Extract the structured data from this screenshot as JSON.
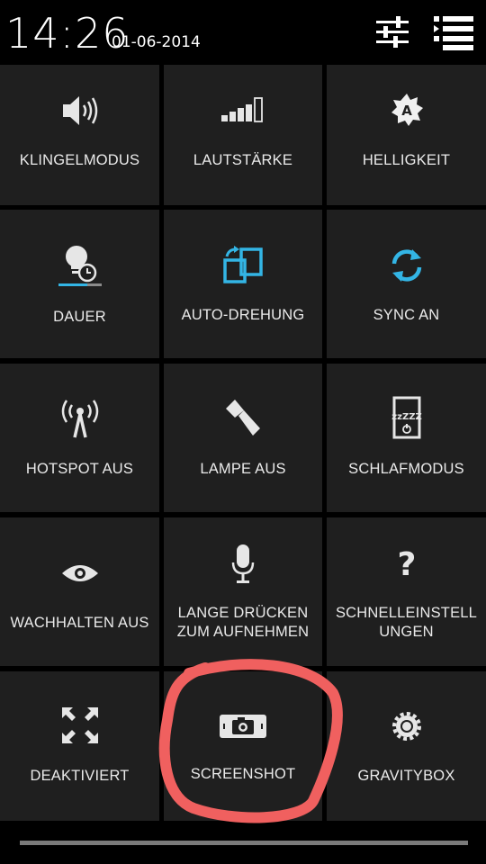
{
  "status": {
    "time": "14:26",
    "date": "01-06-2014"
  },
  "tiles": [
    {
      "label": "KLINGELMODUS",
      "icon": "speaker-icon"
    },
    {
      "label": "LAUTSTÄRKE",
      "icon": "volume-bars-icon"
    },
    {
      "label": "HELLIGKEIT",
      "icon": "brightness-auto-icon"
    },
    {
      "label": "DAUER",
      "icon": "bulb-timer-icon"
    },
    {
      "label": "AUTO-DREHUNG",
      "icon": "rotate-icon"
    },
    {
      "label": "SYNC AN",
      "icon": "sync-icon"
    },
    {
      "label": "HOTSPOT AUS",
      "icon": "hotspot-icon"
    },
    {
      "label": "LAMPE AUS",
      "icon": "flashlight-icon"
    },
    {
      "label": "SCHLAFMODUS",
      "icon": "sleep-icon"
    },
    {
      "label": "WACHHALTEN AUS",
      "icon": "eye-icon"
    },
    {
      "label_lines": [
        "LANGE DRÜCKEN",
        "ZUM AUFNEHMEN"
      ],
      "icon": "microphone-icon"
    },
    {
      "label_lines": [
        "SCHNELLEINSTELL",
        "UNGEN"
      ],
      "icon": "question-icon"
    },
    {
      "label": "DEAKTIVIERT",
      "icon": "expand-arrows-icon"
    },
    {
      "label": "SCREENSHOT",
      "icon": "camera-icon"
    },
    {
      "label": "GRAVITYBOX",
      "icon": "gear-icon"
    }
  ],
  "colors": {
    "accent": "#33b5e5",
    "tile_bg": "#1f1f1f",
    "annotation": "#f0605f"
  }
}
